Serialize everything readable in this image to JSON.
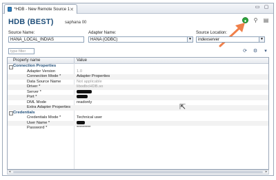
{
  "tab": {
    "label": "*HDB - New Remote Source 1",
    "icon": "database-icon"
  },
  "window_controls": [
    "minimize-icon",
    "maximize-icon"
  ],
  "header": {
    "title": "HDB (BEST)",
    "subtitle": "saphana 00",
    "tools": [
      "add-icon",
      "test-connection-icon",
      "properties-icon"
    ]
  },
  "fields": {
    "source_name_label": "Source Name:",
    "source_name_value": "HANA_LOCAL_INDIAS",
    "adapter_name_label": "Adapter Name:",
    "adapter_name_value": "HANA (ODBC)",
    "source_location_label": "Source Location:",
    "source_location_value": "indexserver"
  },
  "filter": {
    "placeholder": "type filter"
  },
  "grid": {
    "col_property": "Property name",
    "col_value": "Value",
    "sections": [
      {
        "label": "Connection Properties",
        "rows": [
          {
            "key": "Adapter Version",
            "value": "1.0",
            "muted": true
          },
          {
            "key": "Connection Mode *",
            "value": "Adapter Properties"
          },
          {
            "key": "Data Source Name",
            "value": "Not applicable",
            "muted": true
          },
          {
            "key": "Driver *",
            "value": "libodbcHDB.so",
            "muted": true
          },
          {
            "key": "Server *",
            "value": "",
            "redacted": true
          },
          {
            "key": "Port *",
            "value": "",
            "redacted": true
          },
          {
            "key": "DML Mode",
            "value": "readonly"
          },
          {
            "key": "Extra Adapter Properties",
            "value": ""
          }
        ]
      },
      {
        "label": "Credentials",
        "rows": [
          {
            "key": "Credentials Mode *",
            "value": "Technical user"
          },
          {
            "key": "User Name *",
            "value": "",
            "redacted": true
          },
          {
            "key": "Password *",
            "value": "*********"
          }
        ]
      }
    ]
  },
  "colors": {
    "accent": "#1f4e79",
    "arrow": "#f0804a",
    "add": "#2fa83f"
  }
}
